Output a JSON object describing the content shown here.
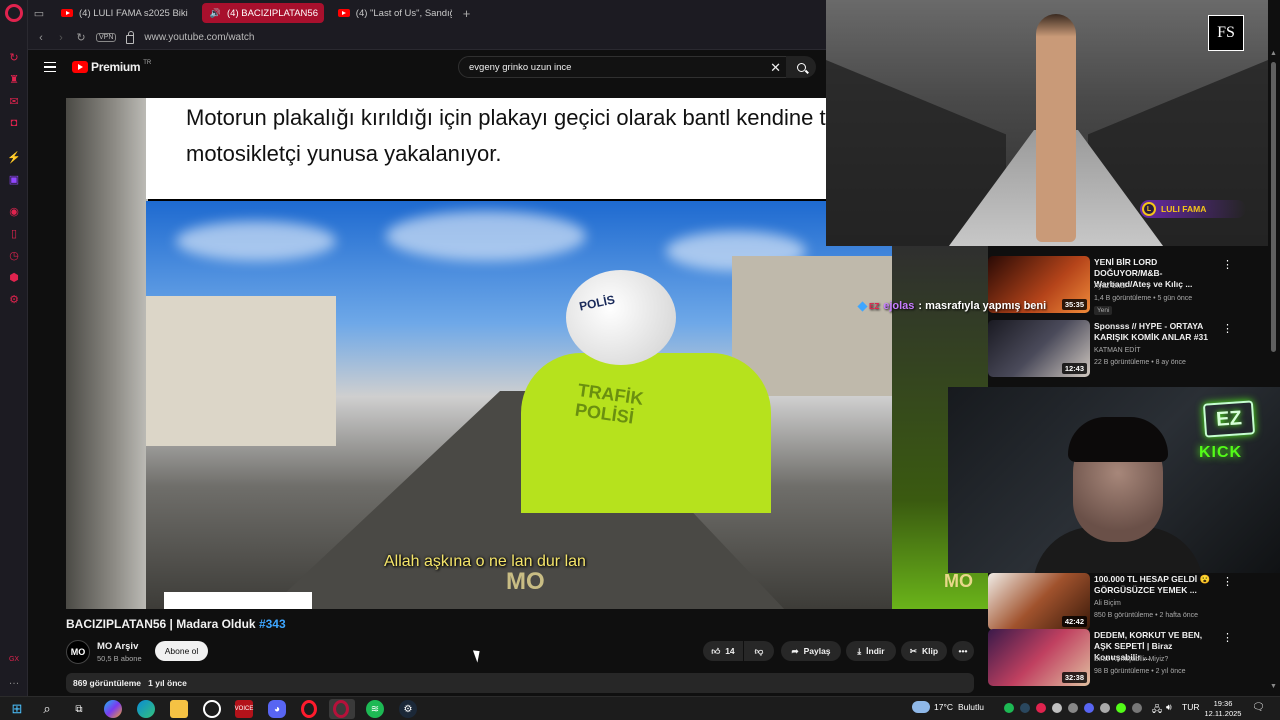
{
  "browser": {
    "tabs": [
      {
        "label": "(4) LULI FAMA s2025 Biki",
        "active": false
      },
      {
        "label": "(4) BACIZIPLATAN56",
        "active": true
      },
      {
        "label": "(4) \"Last of Us\", Sandığım",
        "active": false
      }
    ],
    "vpn_label": "VPN",
    "url": "www.youtube.com/watch"
  },
  "youtube": {
    "logo_word": "Premium",
    "logo_region": "TR",
    "search_value": "evgeny grinko uzun ince"
  },
  "video": {
    "overlay_caption": "Motorun plakalığı kırıldığı için plakayı geçici olarak bantl kendine takan motosikletçi yunusa yakalanıyor.",
    "helmet_text": "POLİS",
    "jacket_text": "TRAFİK POLİSİ",
    "subtitle": "Allah aşkına o ne lan dur lan",
    "watermark": "MO",
    "side_watermark": "MO"
  },
  "info": {
    "title": "BACIZIPLATAN56 | Madara Olduk",
    "hashtag": "#343",
    "channel_avatar": "MO",
    "channel_name": "MO Arşiv",
    "subscribers": "50,5 B abone",
    "subscribe_label": "Abone ol",
    "likes": "14",
    "share_label": "Paylaş",
    "download_label": "İndir",
    "clip_label": "Klip",
    "views": "869 görüntüleme",
    "age": "1 yıl önce"
  },
  "overlay": {
    "fs_logo": "FS",
    "streamer_tag": "LULI FAMA",
    "streamer_tag_initial": "L",
    "chat_user": "ejolas",
    "chat_message": ": masrafıyla yapmış beni",
    "ez_sign": "EZ",
    "kick_sign": "KICK"
  },
  "suggestions": [
    {
      "title": "YENİ BİR LORD DOĞUYOR/M&B- Warband/Ateş ve Kılıç ...",
      "channel": "Ayaz Ünal",
      "meta": "1,4 B görüntüleme • 5 gün önce",
      "duration": "35:35",
      "badge": "Yeni",
      "thumb": "#7a2a10"
    },
    {
      "title": "Sponsss // HYPE - ORTAYA KARIŞIK KOMİK ANLAR #31",
      "channel": "KATMAN EDİT",
      "meta": "22 B görüntüleme • 8 ay önce",
      "duration": "12:43",
      "badge": "",
      "thumb": "#3a3a46"
    },
    {
      "title": "100.000 TL HESAP GELDİ 😮 GÖRGÜSÜZCE YEMEK ...",
      "channel": "Ali Biçim",
      "meta": "850 B görüntüleme • 2 hafta önce",
      "duration": "42:42",
      "badge": "",
      "thumb": "#6a3a20"
    },
    {
      "title": "DEDEM, KORKUT VE BEN, AŞK SEPETİ | Biraz Konuşabilir ...",
      "channel": "Biraz Konuşabilir Miyiz?",
      "meta": "98 B görüntüleme • 2 yıl önce",
      "duration": "32:38",
      "badge": "",
      "thumb": "#3a1a4a"
    }
  ],
  "taskbar": {
    "weather_temp": "17°C",
    "weather_text": "Bulutlu",
    "lang": "TUR",
    "time": "19:36",
    "date": "12.11.2025"
  }
}
